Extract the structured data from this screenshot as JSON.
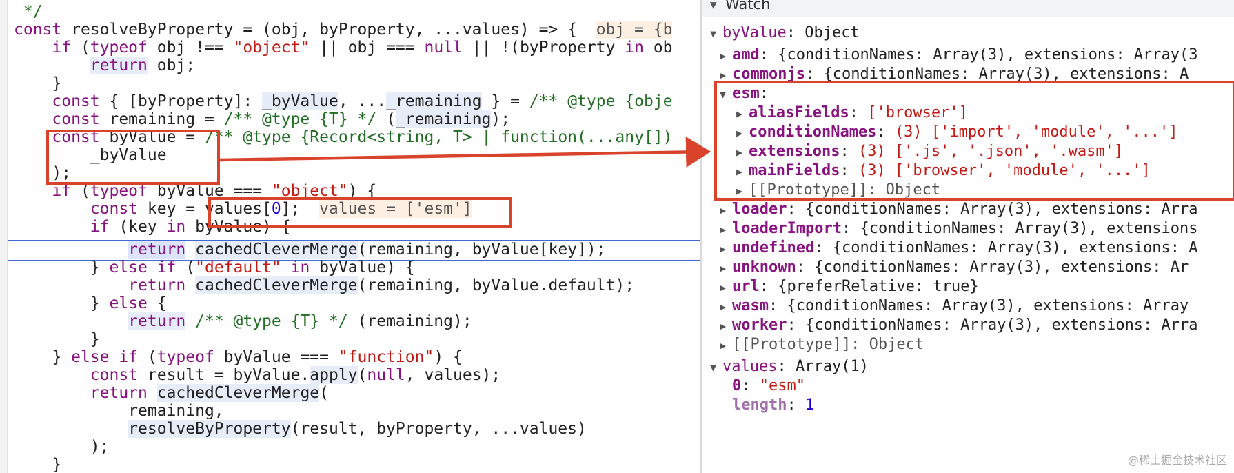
{
  "editor": {
    "lines": [
      {
        "indent": 0,
        "text": " */"
      },
      {
        "indent": 0,
        "text": "const resolveByProperty = (obj, byProperty, ...values) => {",
        "inline": "obj = {b"
      },
      {
        "indent": 1,
        "text": "if (typeof obj !== \"object\" || obj === null || !(byProperty in ob"
      },
      {
        "indent": 2,
        "text": "return obj;"
      },
      {
        "indent": 1,
        "text": "}"
      },
      {
        "indent": 1,
        "text": "const { [byProperty]: _byValue, ..._remaining } = /** @type {obje"
      },
      {
        "indent": 1,
        "text": "const remaining = /** @type {T} */ (_remaining);"
      },
      {
        "indent": 1,
        "text": "const byValue = /** @type {Record<string, T> | function(...any[])"
      },
      {
        "indent": 2,
        "text": "_byValue"
      },
      {
        "indent": 1,
        "text": ");"
      },
      {
        "indent": 1,
        "text": "if (typeof byValue === \"object\") {"
      },
      {
        "indent": 2,
        "text": "const key = values[0];",
        "inline": "values = ['esm']"
      },
      {
        "indent": 2,
        "text": "if (key in byValue) {"
      },
      {
        "indent": 3,
        "text": "return cachedCleverMerge(remaining, byValue[key]);"
      },
      {
        "indent": 2,
        "text": "} else if (\"default\" in byValue) {"
      },
      {
        "indent": 3,
        "text": "return cachedCleverMerge(remaining, byValue.default);"
      },
      {
        "indent": 2,
        "text": "} else {"
      },
      {
        "indent": 3,
        "text": "return /** @type {T} */ (remaining);"
      },
      {
        "indent": 2,
        "text": "}"
      },
      {
        "indent": 1,
        "text": "} else if (typeof byValue === \"function\") {"
      },
      {
        "indent": 2,
        "text": "const result = byValue.apply(null, values);"
      },
      {
        "indent": 2,
        "text": "return cachedCleverMerge("
      },
      {
        "indent": 3,
        "text": "remaining,"
      },
      {
        "indent": 3,
        "text": "resolveByProperty(result, byProperty, ...values)"
      },
      {
        "indent": 2,
        "text": ");"
      },
      {
        "indent": 1,
        "text": "}"
      }
    ]
  },
  "watch": {
    "title": "Watch",
    "byValue": {
      "key": "byValue",
      "value": "Object"
    },
    "entries": [
      {
        "key": "amd",
        "value": "{conditionNames: Array(3), extensions: Array(3"
      },
      {
        "key": "commonjs",
        "value": "{conditionNames: Array(3), extensions: A"
      },
      {
        "key": "loader",
        "value": "{conditionNames: Array(3), extensions: Arra"
      },
      {
        "key": "loaderImport",
        "value": "{conditionNames: Array(3), extensions"
      },
      {
        "key": "undefined",
        "value": "{conditionNames: Array(3), extensions: A"
      },
      {
        "key": "unknown",
        "value": "{conditionNames: Array(3), extensions: Ar"
      },
      {
        "key": "url",
        "value": "{preferRelative: true}"
      },
      {
        "key": "wasm",
        "value": "{conditionNames: Array(3), extensions: Array"
      },
      {
        "key": "worker",
        "value": "{conditionNames: Array(3), extensions: Arra"
      }
    ],
    "esm": {
      "key": "esm",
      "children": [
        {
          "key": "aliasFields",
          "value": "['browser']"
        },
        {
          "key": "conditionNames",
          "value": "(3) ['import', 'module', '...']"
        },
        {
          "key": "extensions",
          "value": "(3) ['.js', '.json', '.wasm']"
        },
        {
          "key": "mainFields",
          "value": "(3) ['browser', 'module', '...']"
        }
      ],
      "prototype": "[[Prototype]]: Object"
    },
    "prototype": "[[Prototype]]: Object",
    "values": {
      "key": "values",
      "value": "Array(1)",
      "item_key": "0",
      "item_value": "\"esm\"",
      "length_key": "length",
      "length_value": "1"
    }
  },
  "watermark": "@稀土掘金技术社区",
  "colors": {
    "annotation": "#d9432c",
    "exec_line": "#3d6bd1",
    "keyword": "#881280",
    "string": "#c41a16",
    "comment": "#236e25"
  }
}
